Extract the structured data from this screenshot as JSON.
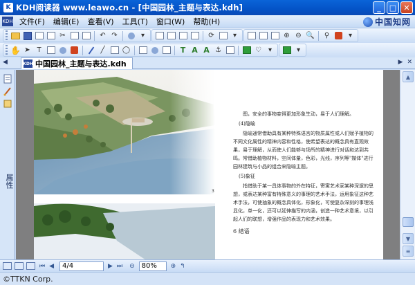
{
  "window": {
    "title": "KDH阅读器 www.leawo.cn - [中国园林_主题与表达.kdh]"
  },
  "menu": {
    "items": [
      "文件(F)",
      "编辑(E)",
      "查看(V)",
      "工具(T)",
      "窗口(W)",
      "帮助(H)"
    ],
    "brand": "中国知网"
  },
  "tab": {
    "label": "中国园林_主题与表达.kdh"
  },
  "side_panel": {
    "label": "属性"
  },
  "document": {
    "figure_number": "3",
    "paragraphs": [
      {
        "type": "body",
        "text": "图，安全的事物变得更加形象生动，易于人们理解。"
      },
      {
        "type": "heading",
        "text": "(4)隐喻"
      },
      {
        "type": "body",
        "text": "隐喻通常借助具有某种特殊语言的物质属性或人们赋予植物的不同文化属性的精神内容和性格，使希望表达的概念具有直观效果，易于理解，从而使人们能够与场所的精神进行对话和达到共鸣。常借助植物材料，空间体量，色彩，光线，序列等\"媒体\"进行园林建筑与小品的组合来隐喻主题。"
      },
      {
        "type": "heading",
        "text": "(5)象征"
      },
      {
        "type": "body",
        "text": "指借助于某一具体事物的外在特征，寄寓艺术家某种深邃的思想，或表达某种富有特殊意义的事理的艺术手法，运用象征这种艺术手法，可使抽象的概念具体化，形象化，可使复杂深刻的事理浅显化，单一化，还可以延伸描写的内涵，创造一种艺术意境，以引起人们的联想，增强作品的表现力和艺术效果。"
      },
      {
        "type": "section",
        "text": "6  结语"
      }
    ]
  },
  "navigation": {
    "page": "4/4",
    "zoom": "80%"
  },
  "status": {
    "text": "©TTKN Corp."
  }
}
